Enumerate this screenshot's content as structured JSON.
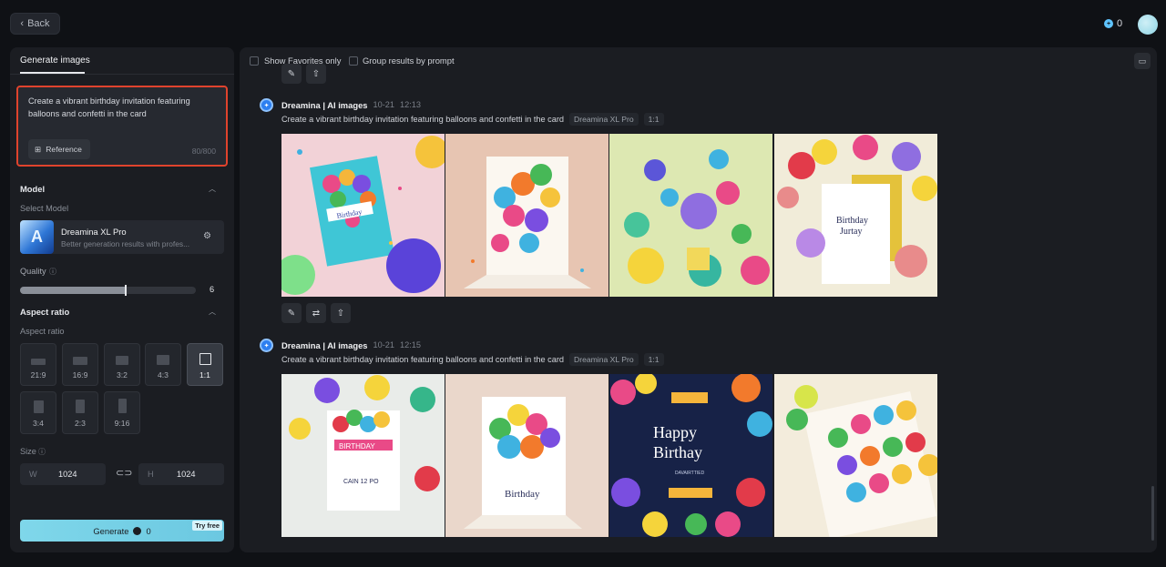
{
  "header": {
    "back_label": "Back",
    "credits": "0"
  },
  "left_panel": {
    "tab": "Generate images",
    "prompt": "Create a vibrant birthday invitation featuring balloons and confetti in the card",
    "reference_label": "Reference",
    "counter": "80/800",
    "model_section": {
      "title": "Model",
      "select_label": "Select Model",
      "model_name": "Dreamina XL Pro",
      "model_desc": "Better generation results with profes..."
    },
    "quality": {
      "label": "Quality",
      "value": "6",
      "fraction": 0.6
    },
    "aspect_section": {
      "title": "Aspect ratio",
      "sub_label": "Aspect ratio",
      "options": [
        "21:9",
        "16:9",
        "3:2",
        "4:3",
        "1:1",
        "3:4",
        "2:3",
        "9:16"
      ],
      "selected": "1:1"
    },
    "size": {
      "label": "Size",
      "w_prefix": "W",
      "w_value": "1024",
      "h_prefix": "H",
      "h_value": "1024"
    },
    "generate": {
      "label": "Generate",
      "cost": "0",
      "badge": "Try free"
    }
  },
  "results": {
    "show_favorites": "Show Favorites only",
    "group_by_prompt": "Group results by prompt",
    "items": [
      {
        "source": "Dreamina | AI images",
        "date": "10-21",
        "time": "12:13",
        "prompt": "Create a vibrant birthday invitation featuring balloons and confetti in the card",
        "model_tag": "Dreamina XL Pro",
        "ratio_tag": "1:1"
      },
      {
        "source": "Dreamina | AI images",
        "date": "10-21",
        "time": "12:15",
        "prompt": "Create a vibrant birthday invitation featuring balloons and confetti in the card",
        "model_tag": "Dreamina XL Pro",
        "ratio_tag": "1:1"
      }
    ],
    "card_texts": {
      "g1_i1": "Birthday",
      "g1_i4_a": "Birthday",
      "g1_i4_b": "Jurtay",
      "g2_i1_a": "BIRTHDAY",
      "g2_i1_b": "CAIN 12 PO",
      "g2_i2": "Birthday",
      "g2_i3_a": "Happy",
      "g2_i3_b": "Birthay",
      "g2_i3_c": "DAVAIRTTIED"
    }
  },
  "colors": {
    "accent": "#6bc8e1",
    "highlight_border": "#e0432d",
    "panel_bg": "#1b1d22"
  }
}
